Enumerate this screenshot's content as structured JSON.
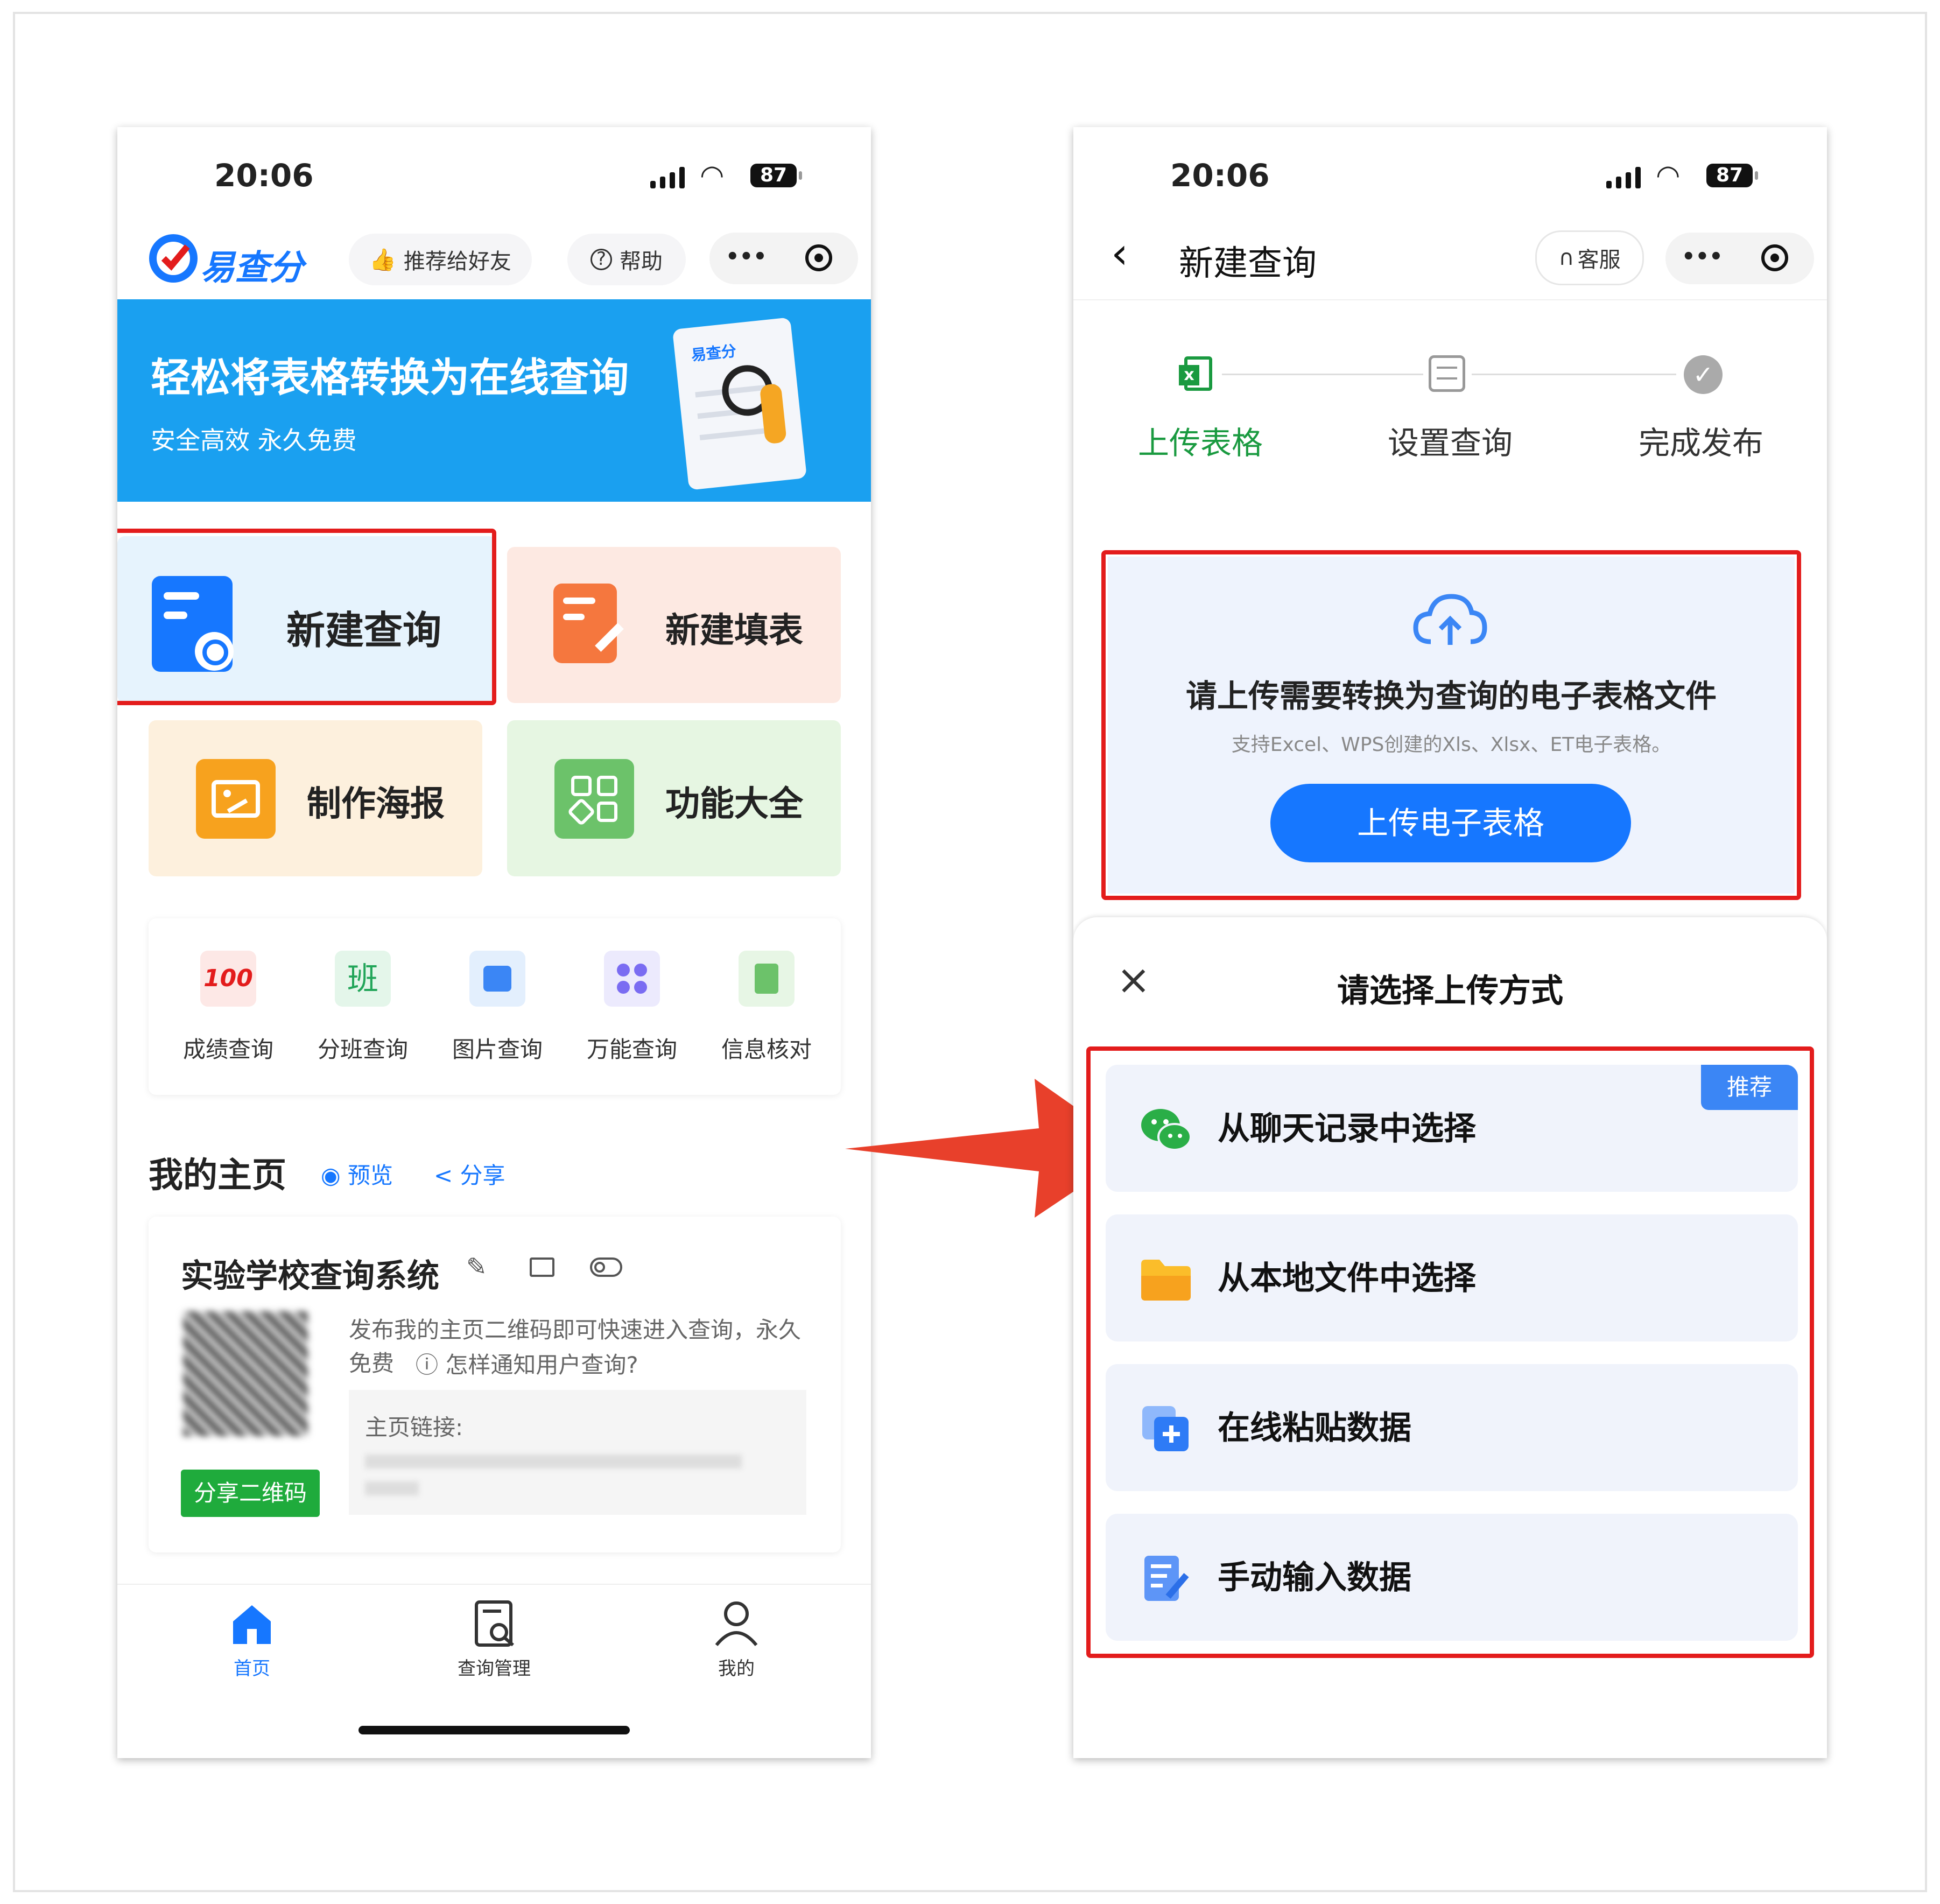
{
  "left": {
    "status": {
      "time": "20:06",
      "battery": "87"
    },
    "header": {
      "logo_text": "易查分",
      "recommend": "推荐给好友",
      "help": "帮助",
      "more": "•••"
    },
    "banner": {
      "title": "轻松将表格转换为在线查询",
      "subtitle": "安全高效 永久免费",
      "art_logo": "易查分"
    },
    "actions": {
      "new_query": "新建查询",
      "new_form": "新建填表",
      "poster": "制作海报",
      "all_features": "功能大全"
    },
    "quick": [
      {
        "label": "成绩查询",
        "glyph": "100"
      },
      {
        "label": "分班查询",
        "glyph": "班"
      },
      {
        "label": "图片查询",
        "glyph": ""
      },
      {
        "label": "万能查询",
        "glyph": ""
      },
      {
        "label": "信息核对",
        "glyph": ""
      }
    ],
    "homepage": {
      "title": "我的主页",
      "preview": "预览",
      "share": "分享"
    },
    "system": {
      "name": "实验学校查询系统",
      "desc": "发布我的主页二维码即可快速进入查询，永久免费",
      "help_link": "怎样通知用户查询?",
      "link_label": "主页链接:",
      "share_qr": "分享二维码"
    },
    "tabbar": [
      {
        "label": "首页"
      },
      {
        "label": "查询管理"
      },
      {
        "label": "我的"
      }
    ]
  },
  "right": {
    "status": {
      "time": "20:06",
      "battery": "87"
    },
    "nav": {
      "back": "‹",
      "title": "新建查询",
      "service": "客服",
      "more": "•••"
    },
    "steps": [
      {
        "label": "上传表格",
        "active": true
      },
      {
        "label": "设置查询",
        "active": false
      },
      {
        "label": "完成发布",
        "active": false
      }
    ],
    "upload": {
      "title": "请上传需要转换为查询的电子表格文件",
      "hint": "支持Excel、WPS创建的Xls、Xlsx、ET电子表格。",
      "button": "上传电子表格"
    },
    "sheet": {
      "close": "×",
      "title": "请选择上传方式",
      "badge": "推荐",
      "options": [
        {
          "label": "从聊天记录中选择",
          "icon": "wechat-icon"
        },
        {
          "label": "从本地文件中选择",
          "icon": "folder-icon"
        },
        {
          "label": "在线粘贴数据",
          "icon": "paste-add-icon"
        },
        {
          "label": "手动输入数据",
          "icon": "manual-input-icon"
        }
      ]
    }
  },
  "colors": {
    "accent_blue": "#1677ff",
    "banner_blue": "#1aa0f0",
    "green_active": "#1a9a40",
    "highlight_red": "#e31c1c",
    "arrow_red": "#e8402b"
  }
}
